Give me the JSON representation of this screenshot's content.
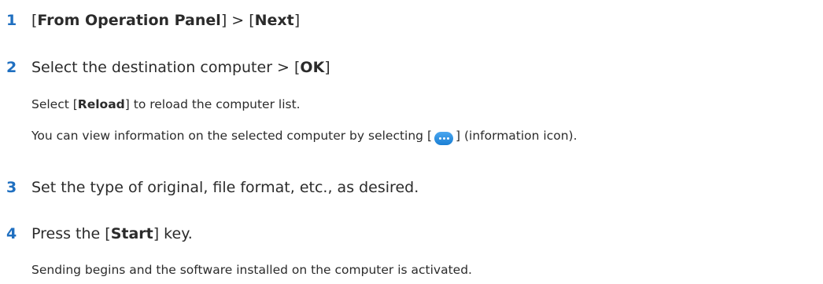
{
  "steps": [
    {
      "number": "1",
      "pre1": "[",
      "bold1": "From Operation Panel",
      "mid1": "] > [",
      "bold2": "Next",
      "post": "]"
    },
    {
      "number": "2",
      "pre": "Select the destination computer > [",
      "bold": "OK",
      "post": "]",
      "notes": [
        {
          "pre": "Select [",
          "bold": "Reload",
          "post": "] to reload the computer list."
        },
        {
          "pre": "You can view information on the selected computer by selecting [",
          "icon": "information-icon",
          "post": "] (information icon)."
        }
      ]
    },
    {
      "number": "3",
      "text": "Set the type of original, file format, etc., as desired."
    },
    {
      "number": "4",
      "pre": "Press the [",
      "bold": "Start",
      "post": "] key.",
      "notes": [
        {
          "text": "Sending begins and the software installed on the computer is activated."
        }
      ]
    }
  ],
  "colors": {
    "step_number": "#1f6fc0",
    "text": "#2b2b2b",
    "info_icon": "#1a7fd4"
  }
}
